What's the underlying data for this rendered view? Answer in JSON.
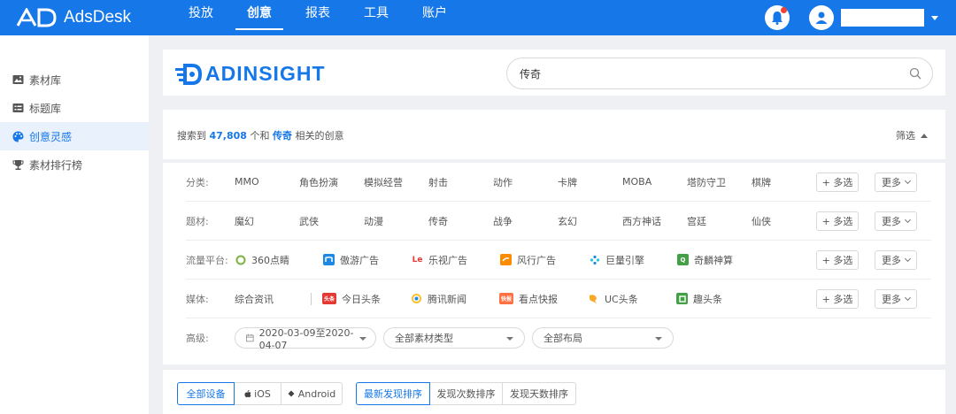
{
  "app": {
    "name": "AdsDesk"
  },
  "nav": [
    {
      "label": "投放",
      "active": false
    },
    {
      "label": "创意",
      "active": true
    },
    {
      "label": "报表",
      "active": false
    },
    {
      "label": "工具",
      "active": false
    },
    {
      "label": "账户",
      "active": false
    }
  ],
  "sidebar": {
    "items": [
      {
        "label": "素材库",
        "icon": "image-folder-icon",
        "active": false
      },
      {
        "label": "标题库",
        "icon": "list-icon",
        "active": false
      },
      {
        "label": "创意灵感",
        "icon": "palette-icon",
        "active": true
      },
      {
        "label": "素材排行榜",
        "icon": "trophy-icon",
        "active": false
      }
    ]
  },
  "search": {
    "logo_text": "ADINSIGHT",
    "value": "传奇"
  },
  "result": {
    "prefix": "搜索到",
    "count": "47,808",
    "middle": "个和",
    "keyword": "传奇",
    "suffix": "相关的创意",
    "filter_toggle": "筛选"
  },
  "filters": {
    "multi_label": "+ 多选",
    "more_label": "更多",
    "category": {
      "label": "分类:",
      "items": [
        "MMO",
        "角色扮演",
        "模拟经营",
        "射击",
        "动作",
        "卡牌",
        "MOBA",
        "塔防守卫",
        "棋牌"
      ]
    },
    "theme": {
      "label": "题材:",
      "items": [
        "魔幻",
        "武侠",
        "动漫",
        "传奇",
        "战争",
        "玄幻",
        "西方神话",
        "宫廷",
        "仙侠"
      ]
    },
    "platform": {
      "label": "流量平台:",
      "items": [
        {
          "label": "360点睛",
          "icon": "360-icon",
          "color": "#7cb342"
        },
        {
          "label": "傲游广告",
          "icon": "maxthon-icon",
          "color": "#1e88e5"
        },
        {
          "label": "乐视广告",
          "icon": "letv-icon",
          "color": "#e53935",
          "icon_text": "Le"
        },
        {
          "label": "风行广告",
          "icon": "funshion-icon",
          "color": "#fb8c00"
        },
        {
          "label": "巨量引擎",
          "icon": "oceanengine-icon",
          "color": "#1e88e5"
        },
        {
          "label": "奇麟神算",
          "icon": "qilin-icon",
          "color": "#43a047",
          "icon_text": "Q"
        }
      ]
    },
    "media": {
      "label": "媒体:",
      "items": [
        {
          "label": "综合资讯",
          "icon": "",
          "color": ""
        },
        {
          "label": "今日头条",
          "icon": "toutiao-icon",
          "color": "#e53935",
          "icon_text": "头条"
        },
        {
          "label": "腾讯新闻",
          "icon": "tencent-news-icon",
          "color": "#fbc02d"
        },
        {
          "label": "看点快报",
          "icon": "kandian-icon",
          "color": "#ff7043",
          "icon_text": "快报"
        },
        {
          "label": "UC头条",
          "icon": "uc-icon",
          "color": "#f9a825"
        },
        {
          "label": "趣头条",
          "icon": "qutoutiao-icon",
          "color": "#43a047"
        }
      ]
    },
    "advanced": {
      "label": "高级:",
      "date_range": "2020-03-09至2020-04-07",
      "material_type": "全部素材类型",
      "layout": "全部布局"
    }
  },
  "sort": {
    "devices": [
      "全部设备",
      "iOS",
      "Android"
    ],
    "orders": [
      "最新发现排序",
      "发现次数排序",
      "发现天数排序"
    ]
  }
}
